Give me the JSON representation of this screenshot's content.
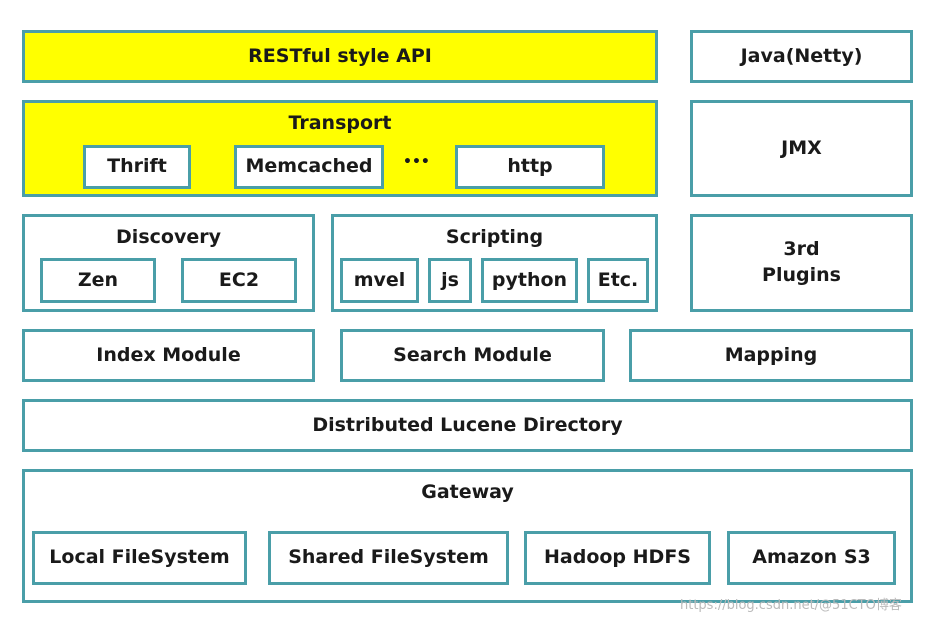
{
  "colors": {
    "border": "#4a9ea8",
    "highlight": "#ffff00"
  },
  "restful": "RESTful style API",
  "java_netty": "Java(Netty)",
  "transport": {
    "title": "Transport",
    "items": [
      "Thrift",
      "Memcached",
      "http"
    ],
    "ellipsis": "•••"
  },
  "jmx": "JMX",
  "discovery": {
    "title": "Discovery",
    "items": [
      "Zen",
      "EC2"
    ]
  },
  "scripting": {
    "title": "Scripting",
    "items": [
      "mvel",
      "js",
      "python",
      "Etc."
    ]
  },
  "plugins": "3rd\nPlugins",
  "index_module": "Index Module",
  "search_module": "Search Module",
  "mapping": "Mapping",
  "lucene": "Distributed Lucene Directory",
  "gateway": {
    "title": "Gateway",
    "items": [
      "Local FileSystem",
      "Shared FileSystem",
      "Hadoop HDFS",
      "Amazon S3"
    ]
  },
  "watermark": "https://blog.csdn.net/@51CTO博客"
}
